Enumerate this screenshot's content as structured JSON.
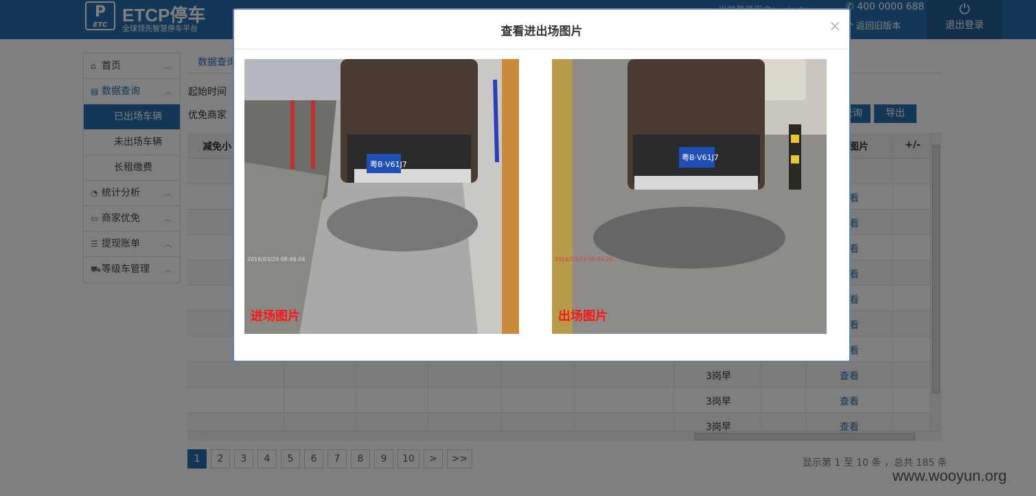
{
  "header": {
    "logo_text": "P",
    "logo_sub": "ETC",
    "brand": "ETCP停车",
    "slogan": "全球领先智慧停车平台",
    "current_user": "当前登录用户：wisctcc",
    "phone": "400 0000 688",
    "old_version": "返回旧版本",
    "logout": "退出登录"
  },
  "sidebar": {
    "items": [
      {
        "label": "首页",
        "icon": "home-icon"
      },
      {
        "label": "数据查询",
        "icon": "document-icon"
      },
      {
        "label": "统计分析",
        "icon": "pie-chart-icon"
      },
      {
        "label": "商家优免",
        "icon": "ticket-icon"
      },
      {
        "label": "提现账单",
        "icon": "list-icon"
      },
      {
        "label": "等级车管理",
        "icon": "car-icon"
      }
    ],
    "subitems": [
      "已出场车辆",
      "未出场车辆",
      "长租缴费"
    ]
  },
  "main": {
    "breadcrumb": "数据查询",
    "start_time_label": "起始时间",
    "merchant_label": "优免商家",
    "query_button": "查询",
    "export_button": "导出",
    "table": {
      "col_first": "减免小",
      "col_img": "场图片",
      "col_toggle": "+/-",
      "rows": [
        {
          "class": "",
          "view": ""
        },
        {
          "class": "",
          "view": "查看"
        },
        {
          "class": "",
          "view": "查看"
        },
        {
          "class": "",
          "view": "查看"
        },
        {
          "class": "",
          "view": "查看"
        },
        {
          "class": "",
          "view": "查看"
        },
        {
          "class": "",
          "view": "查看"
        },
        {
          "class": "",
          "view": "查看"
        },
        {
          "class": "3岗早",
          "view": "查看"
        },
        {
          "class": "3岗早",
          "view": "查看"
        },
        {
          "class": "3岗早",
          "view": "查看"
        }
      ]
    },
    "pagination": [
      "1",
      "2",
      "3",
      "4",
      "5",
      "6",
      "7",
      "8",
      "9",
      "10",
      ">",
      ">>"
    ],
    "current_page": "1",
    "summary": "显示第 1 至 10 条 ，总共 185 条"
  },
  "watermark": "www.wooyun.org",
  "modal": {
    "title": "查看进出场图片",
    "close": "×",
    "entry_caption": "进场图片",
    "exit_caption": "出场图片",
    "entry_stamp": "2016/03/29 08:46:04",
    "exit_stamp": "2016/03/29 08:46:28",
    "plate": "粤B·V61J7"
  }
}
